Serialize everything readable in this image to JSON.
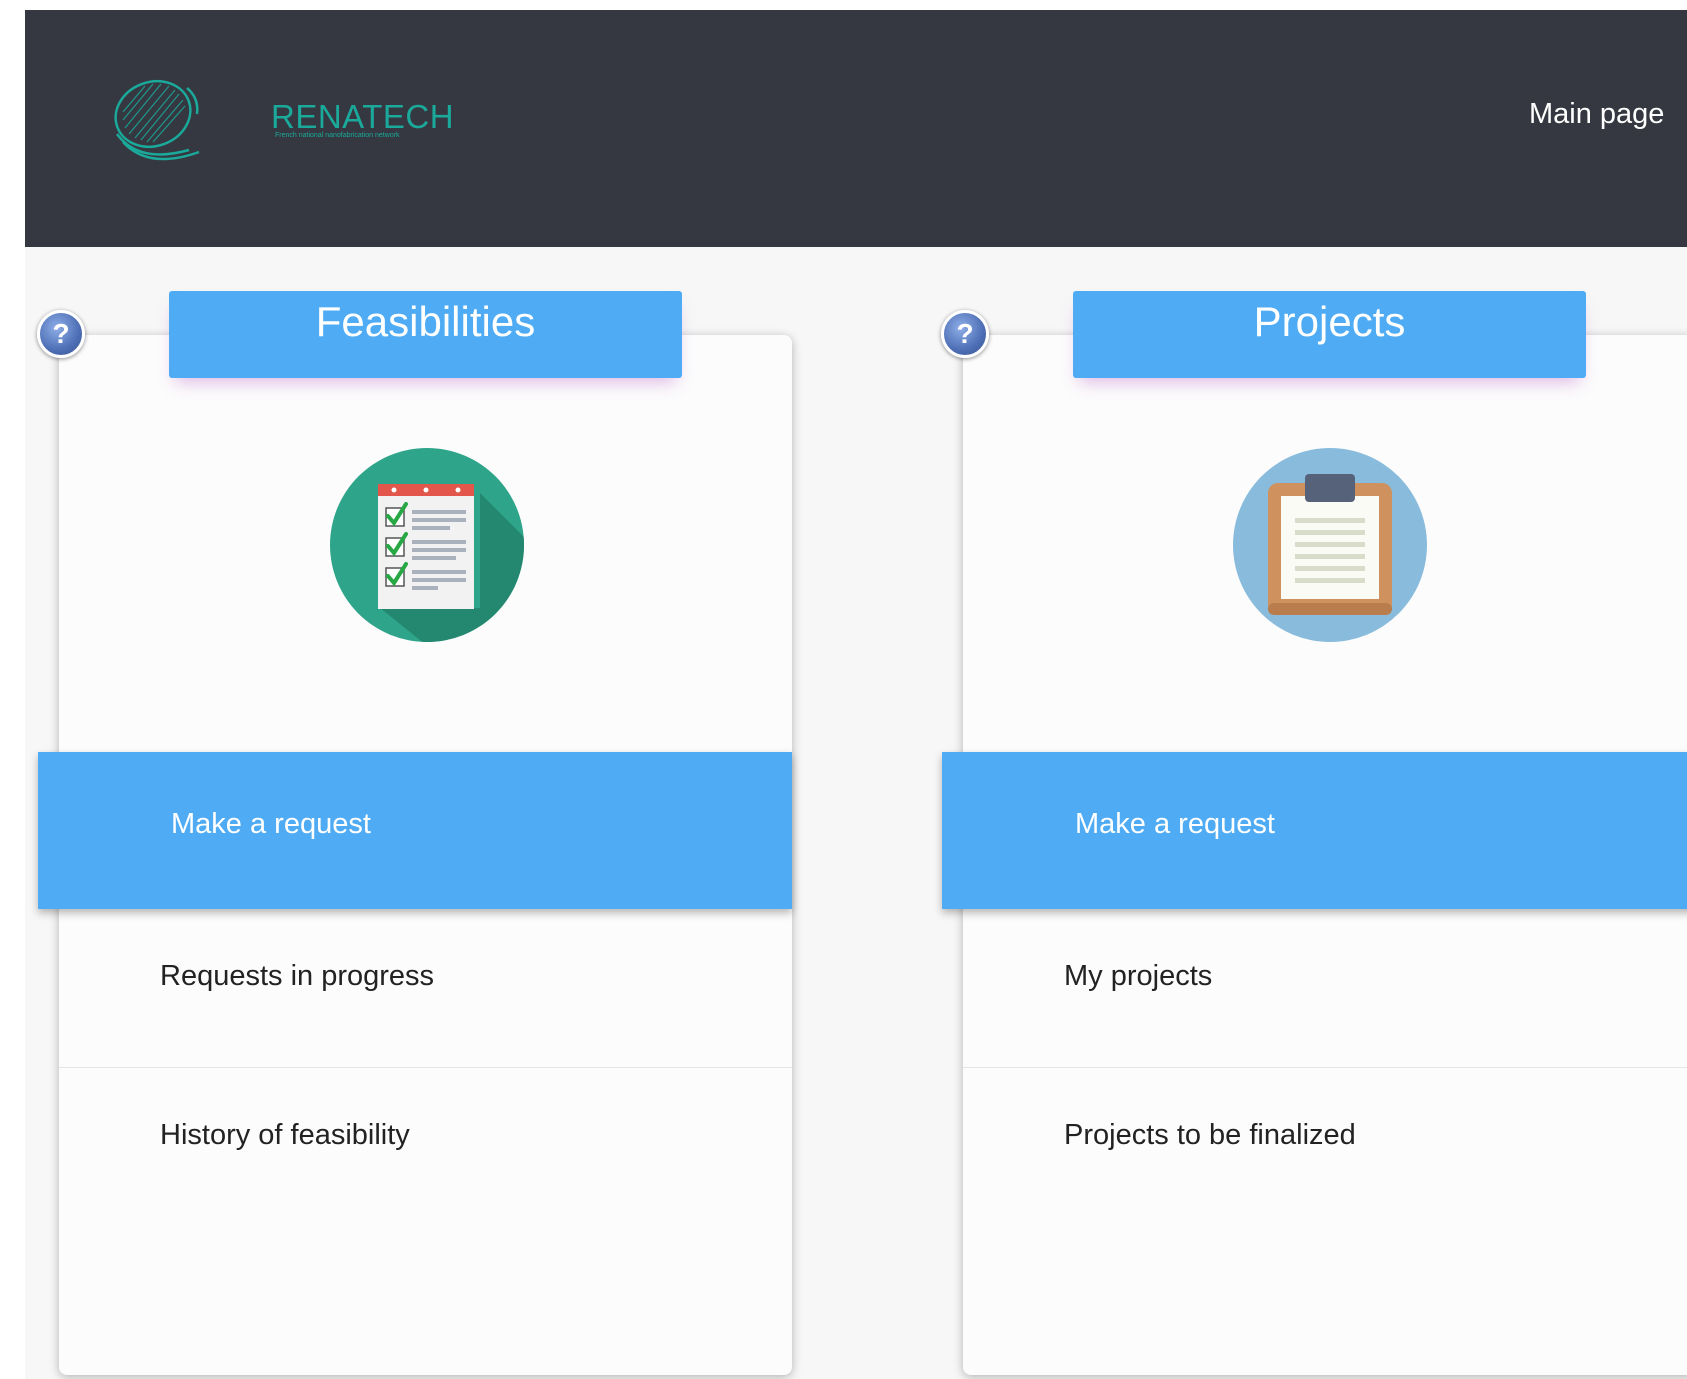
{
  "header": {
    "logo_text": "RENATECH",
    "logo_tagline": "French national nanofabrication network",
    "nav": {
      "main_page": "Main page"
    }
  },
  "colors": {
    "header_bg": "#353840",
    "accent_blue": "#4facf4",
    "logo_teal": "#1aa99a",
    "page_bg": "#f7f7f7"
  },
  "cards": [
    {
      "title": "Feasibilities",
      "icon": "checklist-icon",
      "help_glyph": "?",
      "primary_action": "Make a request",
      "links": [
        "Requests in progress",
        "History of feasibility"
      ]
    },
    {
      "title": "Projects",
      "icon": "clipboard-icon",
      "help_glyph": "?",
      "primary_action": "Make a request",
      "links": [
        "My projects",
        "Projects to be finalized"
      ]
    }
  ]
}
